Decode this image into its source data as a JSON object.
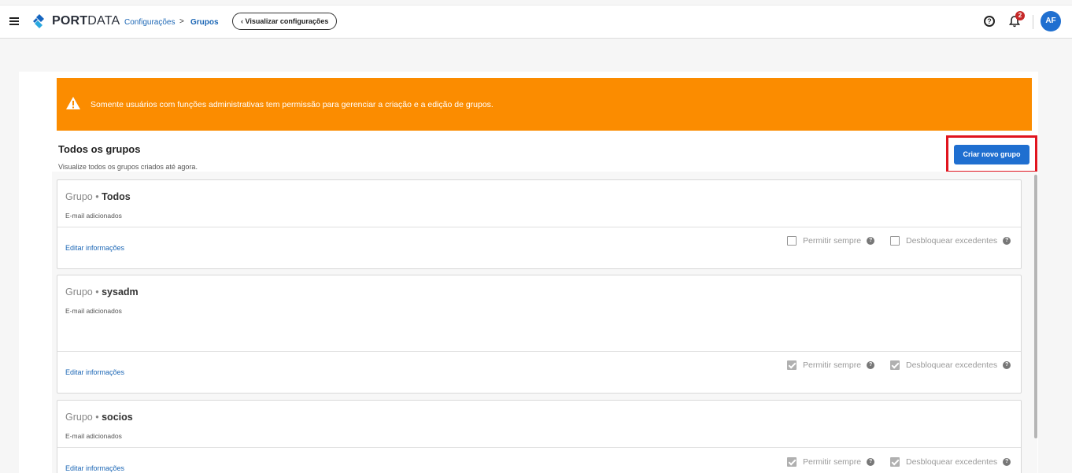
{
  "header": {
    "brand_bold": "PORT",
    "brand_light": "DATA",
    "breadcrumb": [
      "Configurações",
      "Grupos"
    ],
    "breadcrumb_sep": ">",
    "view_settings_label": "‹  Visualizar configurações",
    "help_icon": "?",
    "notifications_count": "2",
    "avatar_initials": "AF"
  },
  "alert": {
    "text": "Somente usuários com funções administrativas tem permissão para gerenciar a criação e a edição de grupos.",
    "color": "#fb8c00"
  },
  "section": {
    "title": "Todos os grupos",
    "subtitle": "Visualize todos os grupos criados até agora.",
    "create_button": "Criar novo grupo"
  },
  "groups": [
    {
      "prefix": "Grupo",
      "dot": "•",
      "name": "Todos",
      "subtitle": "E-mail adicionados",
      "edit_label": "Editar informações",
      "allow_always_label": "Permitir sempre",
      "allow_always": false,
      "unlock_label": "Desbloquear excedentes",
      "unlock": false
    },
    {
      "prefix": "Grupo",
      "dot": "•",
      "name": "sysadm",
      "subtitle": "E-mail adicionados",
      "edit_label": "Editar informações",
      "allow_always_label": "Permitir sempre",
      "allow_always": true,
      "unlock_label": "Desbloquear excedentes",
      "unlock": true
    },
    {
      "prefix": "Grupo",
      "dot": "•",
      "name": "socios",
      "subtitle": "E-mail adicionados",
      "edit_label": "Editar informações",
      "allow_always_label": "Permitir sempre",
      "allow_always": true,
      "unlock_label": "Desbloquear excedentes",
      "unlock": true
    }
  ],
  "colors": {
    "primary": "#1f6fd0",
    "highlight": "#e0141e"
  }
}
